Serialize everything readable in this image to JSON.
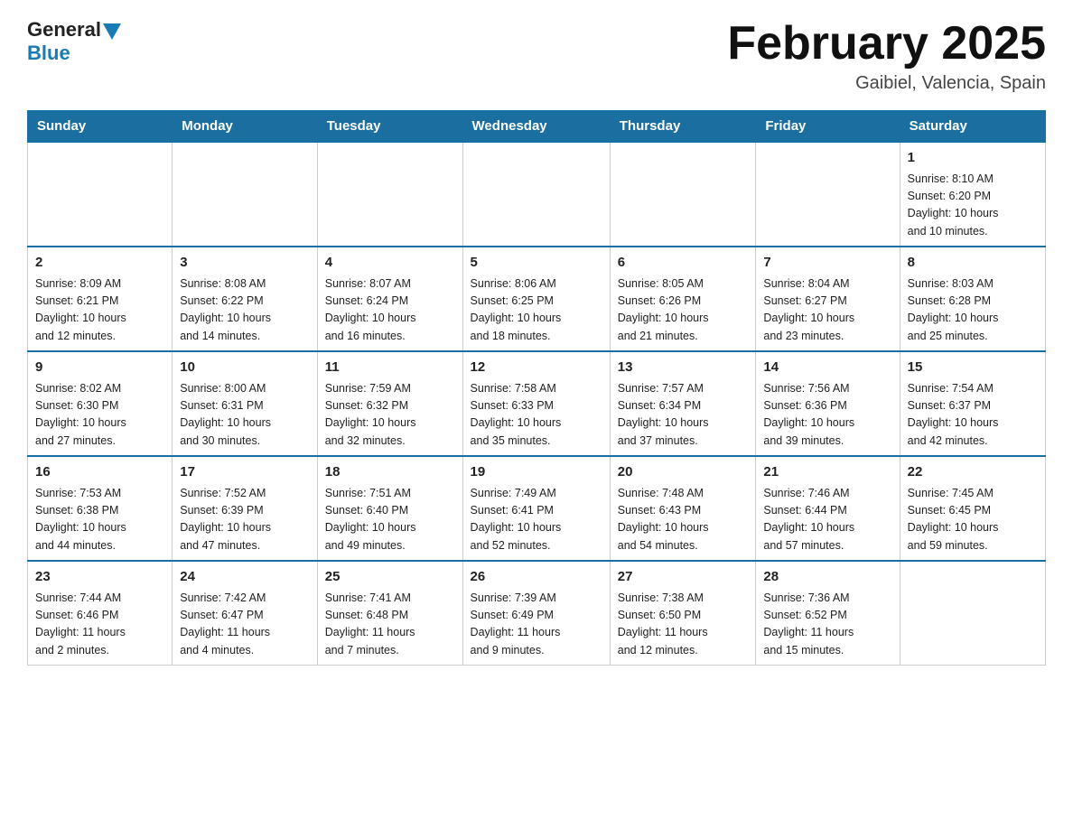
{
  "header": {
    "logo": {
      "general": "General",
      "blue": "Blue"
    },
    "title": "February 2025",
    "location": "Gaibiel, Valencia, Spain"
  },
  "weekdays": [
    "Sunday",
    "Monday",
    "Tuesday",
    "Wednesday",
    "Thursday",
    "Friday",
    "Saturday"
  ],
  "weeks": [
    [
      {
        "day": "",
        "info": ""
      },
      {
        "day": "",
        "info": ""
      },
      {
        "day": "",
        "info": ""
      },
      {
        "day": "",
        "info": ""
      },
      {
        "day": "",
        "info": ""
      },
      {
        "day": "",
        "info": ""
      },
      {
        "day": "1",
        "info": "Sunrise: 8:10 AM\nSunset: 6:20 PM\nDaylight: 10 hours\nand 10 minutes."
      }
    ],
    [
      {
        "day": "2",
        "info": "Sunrise: 8:09 AM\nSunset: 6:21 PM\nDaylight: 10 hours\nand 12 minutes."
      },
      {
        "day": "3",
        "info": "Sunrise: 8:08 AM\nSunset: 6:22 PM\nDaylight: 10 hours\nand 14 minutes."
      },
      {
        "day": "4",
        "info": "Sunrise: 8:07 AM\nSunset: 6:24 PM\nDaylight: 10 hours\nand 16 minutes."
      },
      {
        "day": "5",
        "info": "Sunrise: 8:06 AM\nSunset: 6:25 PM\nDaylight: 10 hours\nand 18 minutes."
      },
      {
        "day": "6",
        "info": "Sunrise: 8:05 AM\nSunset: 6:26 PM\nDaylight: 10 hours\nand 21 minutes."
      },
      {
        "day": "7",
        "info": "Sunrise: 8:04 AM\nSunset: 6:27 PM\nDaylight: 10 hours\nand 23 minutes."
      },
      {
        "day": "8",
        "info": "Sunrise: 8:03 AM\nSunset: 6:28 PM\nDaylight: 10 hours\nand 25 minutes."
      }
    ],
    [
      {
        "day": "9",
        "info": "Sunrise: 8:02 AM\nSunset: 6:30 PM\nDaylight: 10 hours\nand 27 minutes."
      },
      {
        "day": "10",
        "info": "Sunrise: 8:00 AM\nSunset: 6:31 PM\nDaylight: 10 hours\nand 30 minutes."
      },
      {
        "day": "11",
        "info": "Sunrise: 7:59 AM\nSunset: 6:32 PM\nDaylight: 10 hours\nand 32 minutes."
      },
      {
        "day": "12",
        "info": "Sunrise: 7:58 AM\nSunset: 6:33 PM\nDaylight: 10 hours\nand 35 minutes."
      },
      {
        "day": "13",
        "info": "Sunrise: 7:57 AM\nSunset: 6:34 PM\nDaylight: 10 hours\nand 37 minutes."
      },
      {
        "day": "14",
        "info": "Sunrise: 7:56 AM\nSunset: 6:36 PM\nDaylight: 10 hours\nand 39 minutes."
      },
      {
        "day": "15",
        "info": "Sunrise: 7:54 AM\nSunset: 6:37 PM\nDaylight: 10 hours\nand 42 minutes."
      }
    ],
    [
      {
        "day": "16",
        "info": "Sunrise: 7:53 AM\nSunset: 6:38 PM\nDaylight: 10 hours\nand 44 minutes."
      },
      {
        "day": "17",
        "info": "Sunrise: 7:52 AM\nSunset: 6:39 PM\nDaylight: 10 hours\nand 47 minutes."
      },
      {
        "day": "18",
        "info": "Sunrise: 7:51 AM\nSunset: 6:40 PM\nDaylight: 10 hours\nand 49 minutes."
      },
      {
        "day": "19",
        "info": "Sunrise: 7:49 AM\nSunset: 6:41 PM\nDaylight: 10 hours\nand 52 minutes."
      },
      {
        "day": "20",
        "info": "Sunrise: 7:48 AM\nSunset: 6:43 PM\nDaylight: 10 hours\nand 54 minutes."
      },
      {
        "day": "21",
        "info": "Sunrise: 7:46 AM\nSunset: 6:44 PM\nDaylight: 10 hours\nand 57 minutes."
      },
      {
        "day": "22",
        "info": "Sunrise: 7:45 AM\nSunset: 6:45 PM\nDaylight: 10 hours\nand 59 minutes."
      }
    ],
    [
      {
        "day": "23",
        "info": "Sunrise: 7:44 AM\nSunset: 6:46 PM\nDaylight: 11 hours\nand 2 minutes."
      },
      {
        "day": "24",
        "info": "Sunrise: 7:42 AM\nSunset: 6:47 PM\nDaylight: 11 hours\nand 4 minutes."
      },
      {
        "day": "25",
        "info": "Sunrise: 7:41 AM\nSunset: 6:48 PM\nDaylight: 11 hours\nand 7 minutes."
      },
      {
        "day": "26",
        "info": "Sunrise: 7:39 AM\nSunset: 6:49 PM\nDaylight: 11 hours\nand 9 minutes."
      },
      {
        "day": "27",
        "info": "Sunrise: 7:38 AM\nSunset: 6:50 PM\nDaylight: 11 hours\nand 12 minutes."
      },
      {
        "day": "28",
        "info": "Sunrise: 7:36 AM\nSunset: 6:52 PM\nDaylight: 11 hours\nand 15 minutes."
      },
      {
        "day": "",
        "info": ""
      }
    ]
  ]
}
